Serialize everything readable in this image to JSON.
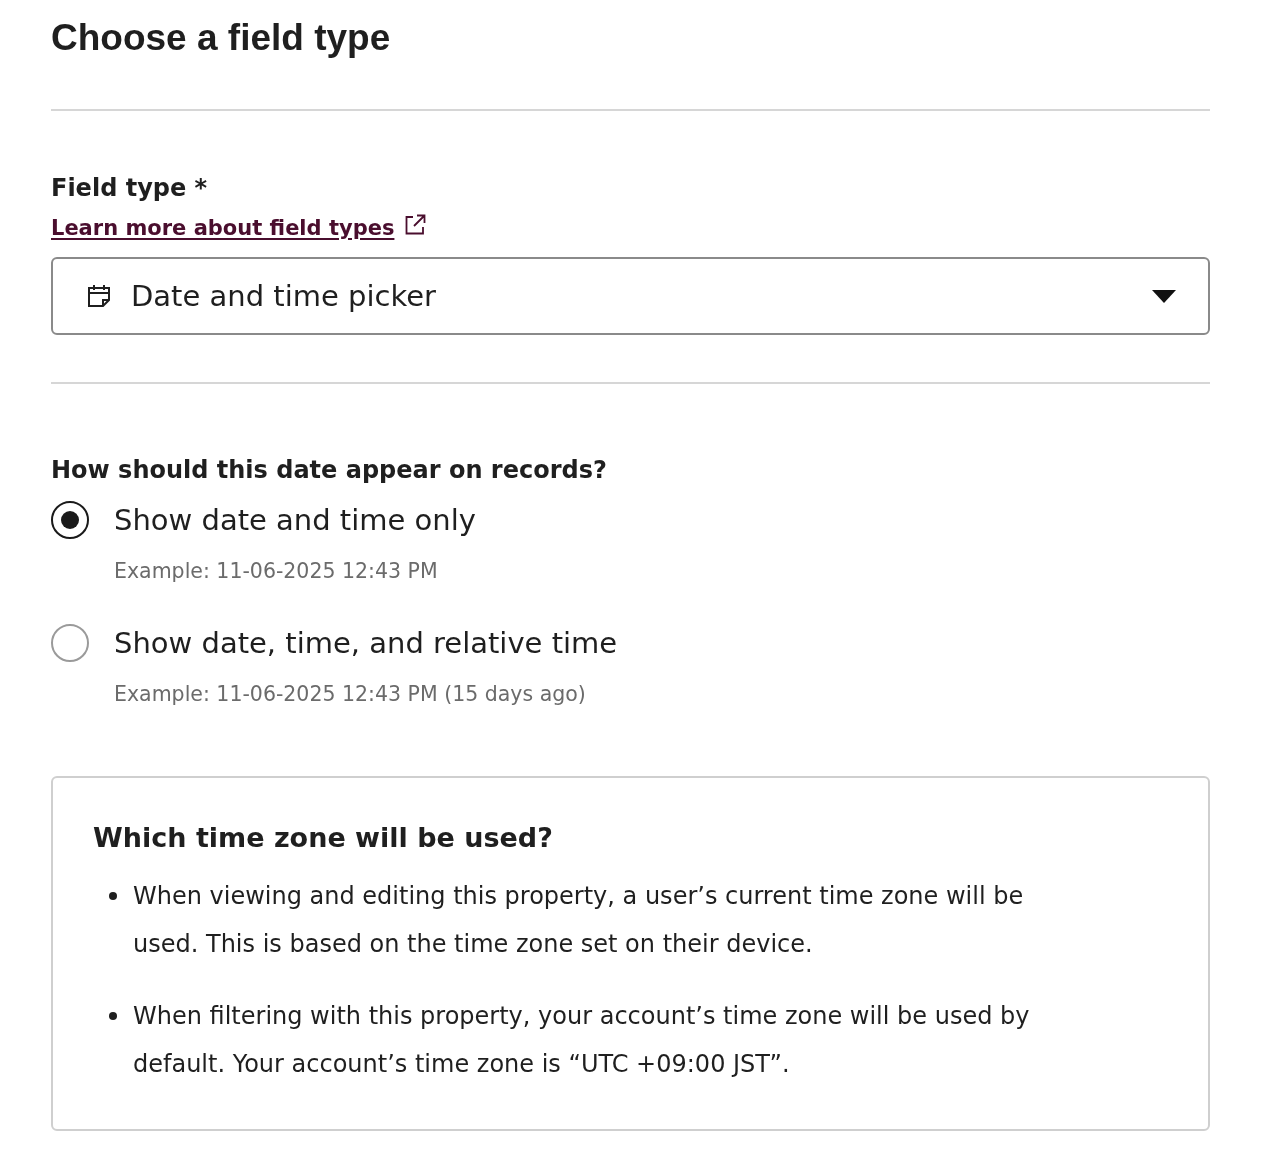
{
  "title": "Choose a field type",
  "field_type": {
    "label": "Field type *",
    "link": "Learn more about field types",
    "dropdown": {
      "value": "Date and time picker"
    }
  },
  "display_format": {
    "question": "How should this date appear on records?",
    "options": [
      {
        "label": "Show date and time only",
        "example": "Example: 11-06-2025 12:43 PM",
        "selected": true
      },
      {
        "label": "Show date, time, and relative time",
        "example": "Example: 11-06-2025 12:43 PM (15 days ago)",
        "selected": false
      }
    ]
  },
  "info_box": {
    "title": "Which time zone will be used?",
    "bullets": [
      "When viewing and editing this property, a user’s current time zone will be used. This is based on the time zone set on their device.",
      "When filtering with this property, your account’s time zone will be used by default. Your account’s time zone is “UTC +09:00 JST”."
    ]
  }
}
